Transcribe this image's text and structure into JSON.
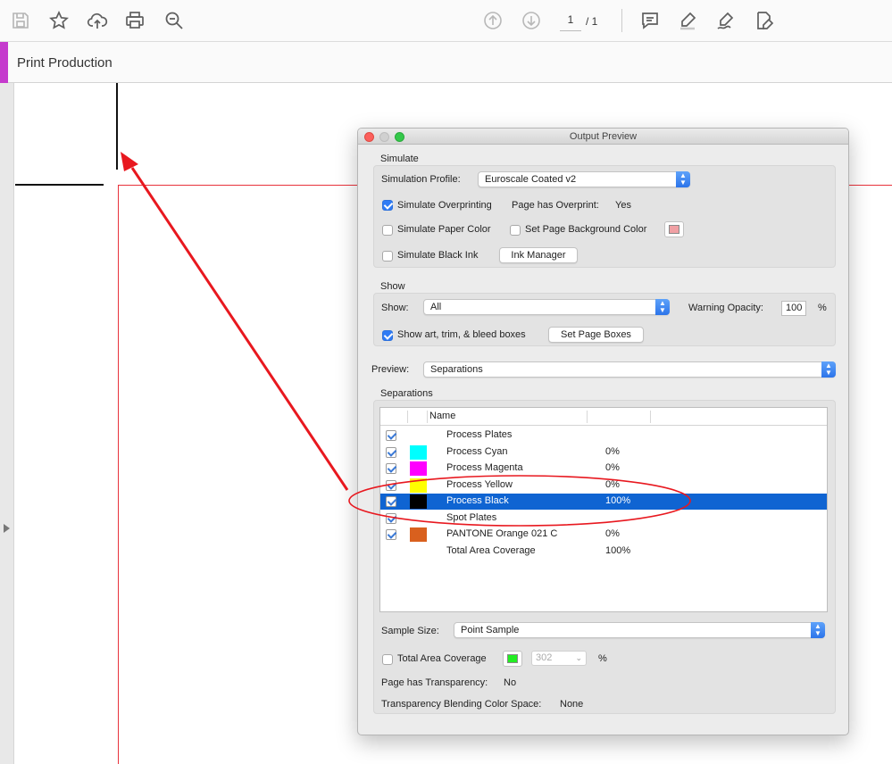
{
  "toolbar": {
    "icons": [
      "save-icon",
      "star-icon",
      "cloud-upload-icon",
      "print-icon",
      "zoom-icon",
      "page-up-icon",
      "page-down-icon",
      "comment-icon",
      "highlight-icon",
      "sign-icon",
      "edit-form-icon"
    ],
    "page_current": "1",
    "page_total": "/ 1"
  },
  "panel": {
    "title": "Print Production",
    "accent_color": "#c53acd"
  },
  "dialog": {
    "title": "Output Preview",
    "simulate": {
      "section_label": "Simulate",
      "profile_label": "Simulation Profile:",
      "profile_value": "Euroscale Coated v2",
      "overprinting_label": "Simulate Overprinting",
      "overprinting_checked": true,
      "page_overprint_label": "Page has Overprint:",
      "page_overprint_value": "Yes",
      "paper_color_label": "Simulate Paper Color",
      "paper_color_checked": false,
      "page_bg_label": "Set Page Background Color",
      "page_bg_checked": false,
      "page_bg_color": "#f0a0a4",
      "black_ink_label": "Simulate Black Ink",
      "black_ink_checked": false,
      "ink_manager_label": "Ink Manager"
    },
    "show": {
      "section_label": "Show",
      "show_label": "Show:",
      "show_value": "All",
      "opacity_label": "Warning Opacity:",
      "opacity_value": "100",
      "opacity_unit": "%",
      "boxes_label": "Show art, trim, & bleed boxes",
      "boxes_checked": true,
      "set_boxes_label": "Set Page Boxes"
    },
    "preview": {
      "label": "Preview:",
      "value": "Separations"
    },
    "separations": {
      "section_label": "Separations",
      "name_header": "Name",
      "rows": [
        {
          "name": "Process Plates",
          "percent": "",
          "checked": true,
          "swatch": null,
          "selected": false
        },
        {
          "name": "Process Cyan",
          "percent": "0%",
          "checked": true,
          "swatch": "#00ffff",
          "selected": false
        },
        {
          "name": "Process Magenta",
          "percent": "0%",
          "checked": true,
          "swatch": "#ff00ff",
          "selected": false
        },
        {
          "name": "Process Yellow",
          "percent": "0%",
          "checked": true,
          "swatch": "#ffff00",
          "selected": false
        },
        {
          "name": "Process Black",
          "percent": "100%",
          "checked": true,
          "swatch": "#000000",
          "selected": true
        },
        {
          "name": "Spot Plates",
          "percent": "",
          "checked": true,
          "swatch": null,
          "selected": false
        },
        {
          "name": "PANTONE Orange 021 C",
          "percent": "0%",
          "checked": true,
          "swatch": "#d9601e",
          "selected": false
        },
        {
          "name": "Total Area Coverage",
          "percent": "100%",
          "checked": false,
          "swatch": null,
          "selected": false
        }
      ]
    },
    "bottom": {
      "sample_label": "Sample Size:",
      "sample_value": "Point Sample",
      "tac_label": "Total Area Coverage",
      "tac_checked": false,
      "tac_color": "#22ee22",
      "tac_value": "302",
      "tac_unit": "%",
      "transparency_label": "Page has Transparency:",
      "transparency_value": "No",
      "blending_label": "Transparency Blending Color Space:",
      "blending_value": "None"
    }
  },
  "annotation_color": "#e8181f"
}
